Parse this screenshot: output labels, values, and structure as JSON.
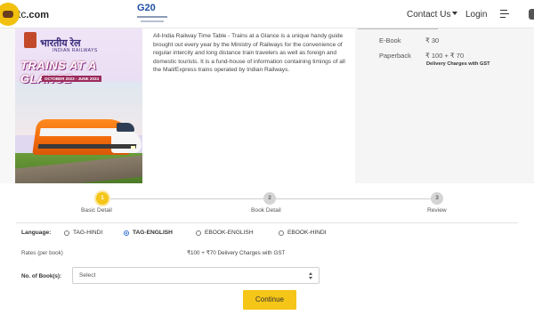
{
  "header": {
    "logo_prefix": "tc",
    "logo_suffix": ".com",
    "g20_label": "G20",
    "nav": {
      "contact_label": "Contact Us",
      "login_label": "Login"
    }
  },
  "product": {
    "cover": {
      "hindi_title": "भारतीय रेल",
      "org_label": "INDIAN RAILWAYS",
      "title": "TRAINS AT A GLANCE",
      "dates": "OCTOBER 2023 - JUNE 2024"
    },
    "description": "All-India Railway Time Table - Trains at a Glance is a unique handy guide brought out every year by the Ministry of Railways for the convenience of regular intercity and long distance train travelers as well as foreign and domestic tourists. It is a fund-house of information containing timings of all the Mail/Express trains operated by Indian Railways.",
    "pricing": {
      "ebook_label": "E-Book",
      "ebook_price": "₹ 30",
      "paperback_label": "Paperback",
      "paperback_price": "₹ 100 + ₹ 70",
      "delivery_note": "Delivery Charges with GST"
    }
  },
  "stepper": {
    "steps": [
      {
        "number": "1",
        "label": "Basic Detail",
        "active": true
      },
      {
        "number": "2",
        "label": "Book Detail",
        "active": false
      },
      {
        "number": "3",
        "label": "Review",
        "active": false
      }
    ]
  },
  "form": {
    "language_label": "Language:",
    "language_options": [
      {
        "label": "TAG-HINDI",
        "selected": false
      },
      {
        "label": "TAG-ENGLISH",
        "selected": true
      },
      {
        "label": "EBOOK-ENGLISH",
        "selected": false
      },
      {
        "label": "EBOOK-HINDI",
        "selected": false
      }
    ],
    "rates_label": "Rates (per book)",
    "rates_value": "₹100 + ₹70 Delivery Charges with GST",
    "books_label": "No. of Book(s):",
    "books_select_value": "Select",
    "continue_label": "Continue"
  },
  "colors": {
    "accent": "#f5c518",
    "radio_selected": "#2f6fd1"
  }
}
